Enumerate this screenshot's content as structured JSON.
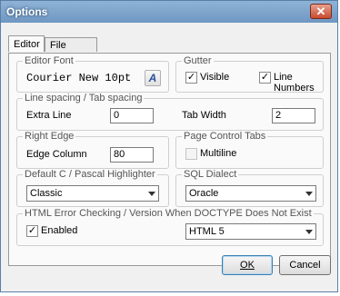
{
  "window": {
    "title": "Options",
    "close_glyph": "✕"
  },
  "tabs": [
    {
      "label": "Editor",
      "active": true
    },
    {
      "label": "File Types",
      "active": false
    }
  ],
  "editor_font": {
    "group_label": "Editor Font",
    "font_name": "Courier New 10pt",
    "font_button_glyph": "A"
  },
  "gutter": {
    "group_label": "Gutter",
    "visible_label": "Visible",
    "visible_checked": true,
    "line_numbers_label": "Line Numbers",
    "line_numbers_checked": true
  },
  "spacing": {
    "group_label": "Line spacing / Tab spacing",
    "extra_line_label": "Extra Line",
    "extra_line_value": "0",
    "tab_width_label": "Tab Width",
    "tab_width_value": "2"
  },
  "right_edge": {
    "group_label": "Right Edge",
    "edge_column_label": "Edge Column",
    "edge_column_value": "80"
  },
  "page_control_tabs": {
    "group_label": "Page Control Tabs",
    "multiline_label": "Multiline",
    "multiline_checked": false
  },
  "highlighter": {
    "group_label": "Default C / Pascal Highlighter",
    "selected": "Classic"
  },
  "sql_dialect": {
    "group_label": "SQL Dialect",
    "selected": "Oracle"
  },
  "html_check": {
    "group_label": "HTML Error Checking / Version When DOCTYPE Does Not Exist",
    "enabled_label": "Enabled",
    "enabled_checked": true,
    "version_selected": "HTML 5"
  },
  "buttons": {
    "ok_label": "OK",
    "cancel_label": "Cancel"
  },
  "check_glyph": "✓"
}
